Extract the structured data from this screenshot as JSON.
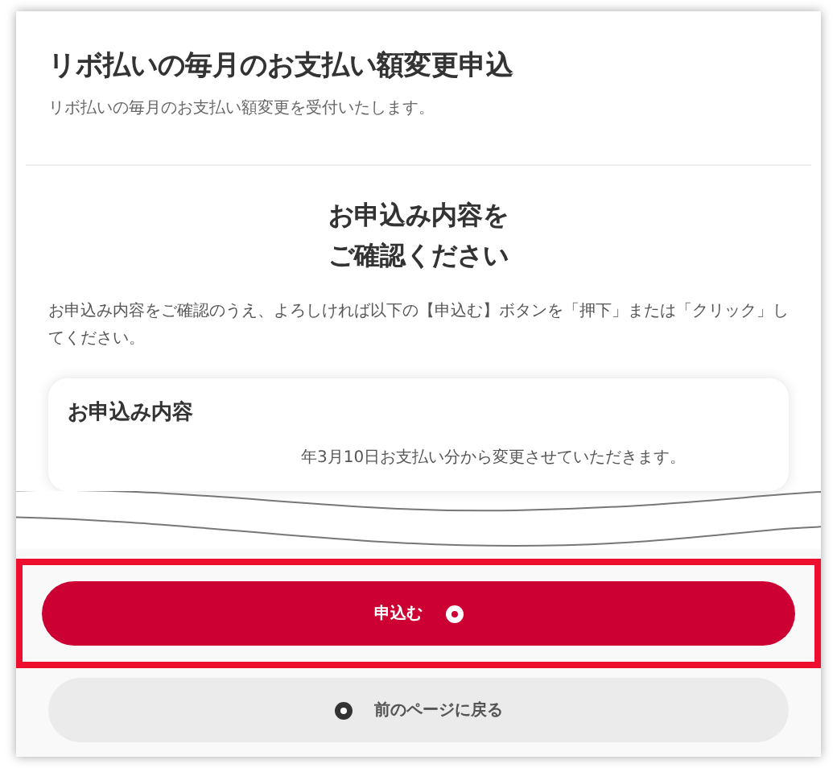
{
  "header": {
    "title": "リボ払いの毎月のお支払い額変更申込",
    "subtitle": "リボ払いの毎月のお支払い額変更を受付いたします。"
  },
  "confirm": {
    "heading_lines": [
      "お申込み内容を",
      "ご確認ください"
    ],
    "instruction": "お申込み内容をご確認のうえ、よろしければ以下の【申込む】ボタンを「押下」または「クリック」してください。"
  },
  "details": {
    "title": "お申込み内容",
    "note": "年3月10日お支払い分から変更させていただきます。"
  },
  "buttons": [
    {
      "kind": "primary",
      "label": "申込む",
      "highlighted": true
    },
    {
      "kind": "secondary",
      "label": "前のページに戻る",
      "highlighted": false
    }
  ]
}
